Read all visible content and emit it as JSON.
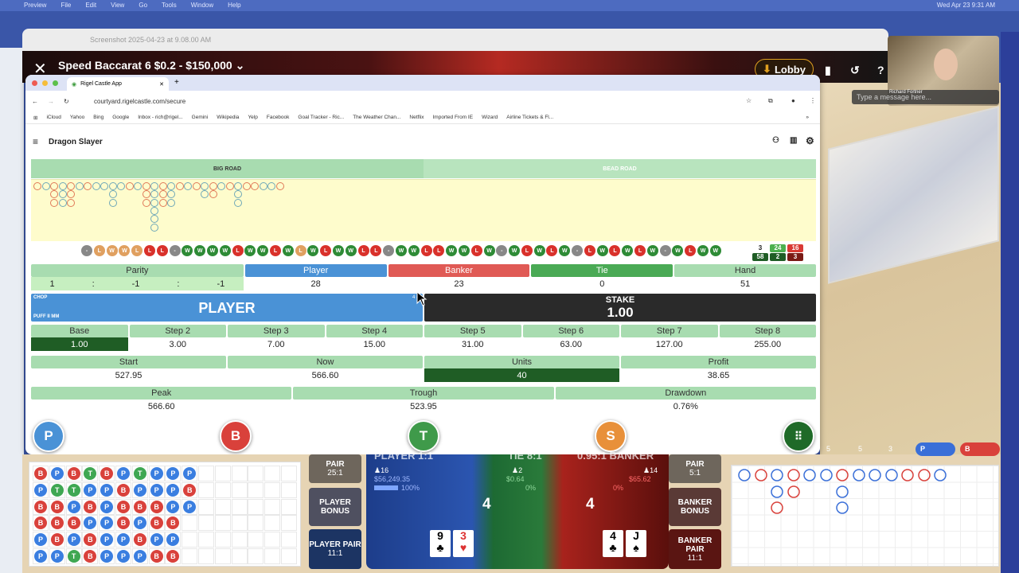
{
  "menubar": {
    "items": [
      "Preview",
      "File",
      "Edit",
      "View",
      "Go",
      "Tools",
      "Window",
      "Help"
    ],
    "clock": "Wed Apr 23  9:31 AM"
  },
  "preview": {
    "title": "Screenshot 2025-04-23 at 9.08.00 AM"
  },
  "game": {
    "close": "✕",
    "title": "Speed Baccarat 6 $0.2 - $150,000 ⌄",
    "lobby": "Lobby",
    "help": "?"
  },
  "webcam": {
    "name": "Richard Fortner",
    "placeholder": "Type a message here..."
  },
  "browser": {
    "tab": "Rigel Castle App",
    "new_tab": "+",
    "url": "courtyard.rigelcastle.com/secure",
    "bookmarks": [
      "iCloud",
      "Yahoo",
      "Bing",
      "Google",
      "Inbox - rich@rigel...",
      "Gemini",
      "Wikipedia",
      "Yelp",
      "Facebook",
      "Goal Tracker - Ric...",
      "The Weather Chan...",
      "Netflix",
      "Imported From IE",
      "Wizard",
      "Airline Tickets & Fl..."
    ],
    "more": "»"
  },
  "app": {
    "title": "Dragon Slayer",
    "tabs": [
      "BIG ROAD",
      "BEAD ROAD"
    ],
    "big_road": [
      "r",
      "b",
      "rrr",
      "bbb",
      "rrr",
      "b",
      "r",
      "b",
      "b",
      "bbb",
      "b",
      "r",
      "b",
      "rrr",
      "bbbbbb",
      "rrr",
      "bbb",
      "r",
      "b",
      "r",
      "bb",
      "rr",
      "b",
      "r",
      "bbb",
      "r",
      "r",
      "b",
      "b",
      "r"
    ],
    "strip": [
      "-",
      "l",
      "w",
      "w",
      "l",
      "L",
      "L",
      "-",
      "W",
      "W",
      "W",
      "W",
      "L",
      "W",
      "W",
      "L",
      "W",
      "l",
      "W",
      "L",
      "W",
      "W",
      "L",
      "L",
      "-",
      "W",
      "W",
      "L",
      "L",
      "W",
      "W",
      "L",
      "W",
      "-",
      "W",
      "L",
      "W",
      "L",
      "W",
      "-",
      "L",
      "W",
      "L",
      "W",
      "L",
      "W",
      "-",
      "W",
      "L",
      "W",
      "W"
    ],
    "counts": {
      "top": "3",
      "bottom": "58",
      "green_top": "24",
      "green_bottom": "2",
      "red_top": "16",
      "red_bottom": "3"
    },
    "stats": {
      "parity_label": "Parity",
      "parity": [
        "1",
        ":",
        "-1",
        ":",
        "-1"
      ],
      "cols": [
        {
          "h": "Player",
          "v": "28"
        },
        {
          "h": "Banker",
          "v": "23"
        },
        {
          "h": "Tie",
          "v": "0"
        },
        {
          "h": "Hand",
          "v": "51"
        }
      ]
    },
    "banner": {
      "tag_top": "CHOP",
      "tag_bottom": "PUFF II MM",
      "label": "PLAYER",
      "corner": "4 -",
      "stake_label": "STAKE",
      "stake": "1.00"
    },
    "steps": [
      {
        "h": "Base",
        "v": "1.00"
      },
      {
        "h": "Step 2",
        "v": "3.00"
      },
      {
        "h": "Step 3",
        "v": "7.00"
      },
      {
        "h": "Step 4",
        "v": "15.00"
      },
      {
        "h": "Step 5",
        "v": "31.00"
      },
      {
        "h": "Step 6",
        "v": "63.00"
      },
      {
        "h": "Step 7",
        "v": "127.00"
      },
      {
        "h": "Step 8",
        "v": "255.00"
      }
    ],
    "money": [
      {
        "h": "Start",
        "v": "527.95"
      },
      {
        "h": "Now",
        "v": "566.60"
      },
      {
        "h": "Units",
        "v": "40"
      },
      {
        "h": "Profit",
        "v": "38.65"
      }
    ],
    "peaks": [
      {
        "h": "Peak",
        "v": "566.60"
      },
      {
        "h": "Trough",
        "v": "523.95"
      },
      {
        "h": "Drawdown",
        "v": "0.76%"
      }
    ],
    "buttons": [
      "P",
      "B",
      "T",
      "S"
    ]
  },
  "table": {
    "bead_rows": [
      "BPBTBPTPPP",
      "PTTPPBPPPB",
      "BBPBPBBBPP",
      "BBBPPBPBB",
      "PBPBPPBPP",
      "PPTBPPPBB"
    ],
    "player_pair": {
      "top": "PAIR",
      "odds": "25:1"
    },
    "player_bonus": "PLAYER BONUS",
    "player_pair2": {
      "label": "PLAYER PAIR",
      "odds": "11:1"
    },
    "banker_pair": {
      "top": "PAIR",
      "odds": "5:1"
    },
    "banker_bonus": "BANKER BONUS",
    "banker_pair2": {
      "label": "BANKER PAIR",
      "odds": "11:1"
    },
    "player": {
      "title": "PLAYER 1:1",
      "players": "16",
      "amount": "$56,249.35",
      "pct": "100%",
      "score": "4",
      "cards": [
        {
          "r": "9",
          "s": "♣"
        },
        {
          "r": "3",
          "s": "♥"
        }
      ]
    },
    "tie": {
      "title": "TIE 8:1",
      "players": "2",
      "amount": "$0.64",
      "pct": "0%"
    },
    "banker": {
      "title": "0.95:1 BANKER",
      "players": "14",
      "amount": "$65.62",
      "pct": "0%",
      "score": "4",
      "cards": [
        {
          "r": "4",
          "s": "♣"
        },
        {
          "r": "J",
          "s": "♠"
        }
      ]
    },
    "tallies": [
      "5",
      "5",
      "3"
    ],
    "predict": [
      "P",
      "B"
    ]
  }
}
